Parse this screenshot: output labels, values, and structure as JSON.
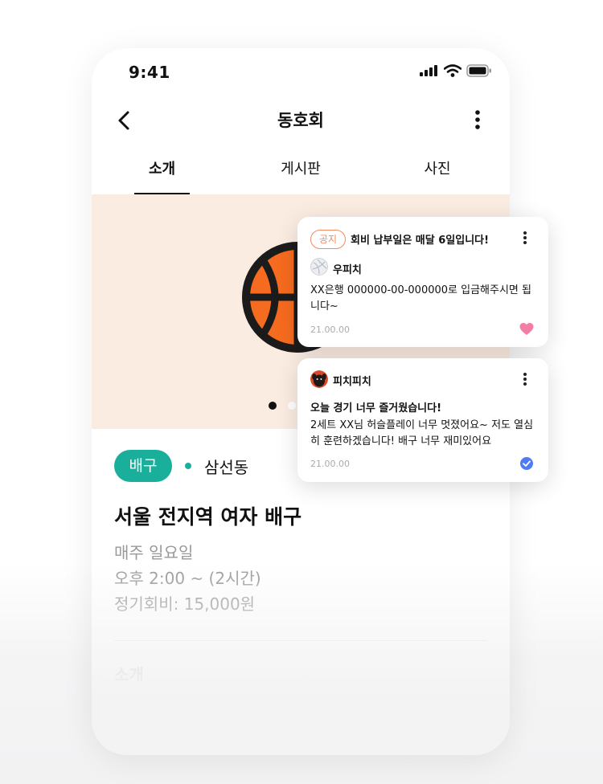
{
  "status_bar": {
    "time": "9:41"
  },
  "nav": {
    "title": "동호회"
  },
  "tabs": [
    {
      "label": "소개",
      "active": true
    },
    {
      "label": "게시판",
      "active": false
    },
    {
      "label": "사진",
      "active": false
    }
  ],
  "hero": {
    "image_icon": "basketball-icon",
    "carousel_dots": 3,
    "active_dot": 1
  },
  "club": {
    "category": "배구",
    "location": "삼선동",
    "title": "서울 전지역 여자 배구",
    "schedule_day": "매주 일요일",
    "schedule_time": "오후 2:00 ~ (2시간)",
    "fee": "정기회비: 15,000원",
    "section_intro": "소개"
  },
  "colors": {
    "accent": "#1aaf9b",
    "notice": "#f28a5e",
    "like": "#f27ea6",
    "check": "#4f7cf3",
    "hero_bg": "#fbece2"
  },
  "posts": [
    {
      "tag": "공지",
      "headline": "회비 납부일은 매달 6일입니다!",
      "author": "우피치",
      "author_avatar": "volleyball-avatar",
      "body": "XX은행 000000-00-000000로 입금해주시면 됩니다~",
      "date": "21.00.00",
      "status_icon": "heart-icon"
    },
    {
      "author": "피치피치",
      "author_avatar": "dog-avatar",
      "headline": "오늘 경기 너무 즐거웠습니다!",
      "body": "2세트 XX님 허슬플레이 너무 멋졌어요~ 저도 열심히 훈련하겠습니다! 배구 너무 재미있어요",
      "date": "21.00.00",
      "status_icon": "check-circle-icon"
    }
  ]
}
